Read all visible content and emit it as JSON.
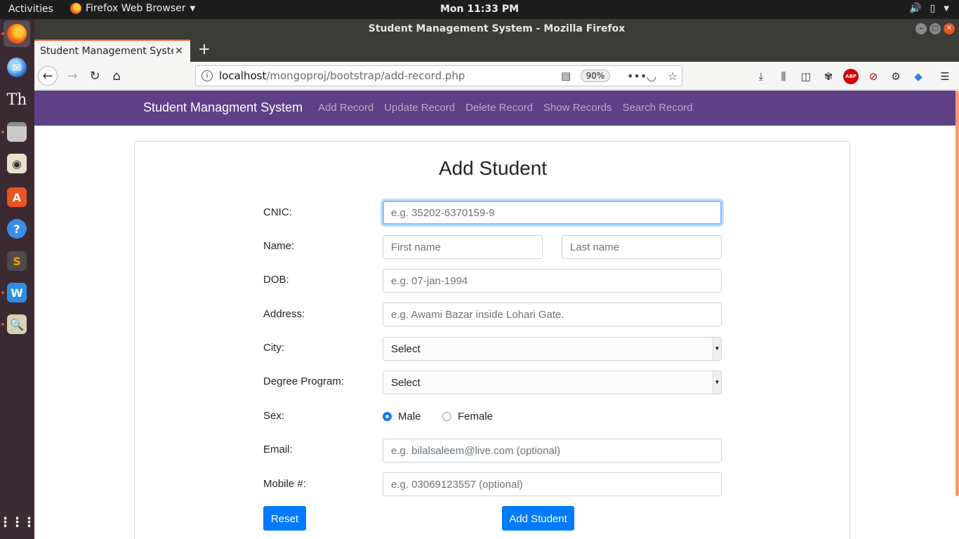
{
  "topbar": {
    "activities": "Activities",
    "app_name": "Firefox Web Browser",
    "clock": "Mon 11:33 PM"
  },
  "dock": {
    "items": [
      "firefox-icon",
      "thunderbird-icon",
      "font-viewer-icon",
      "files-icon",
      "rhythmbox-icon",
      "software-center-icon",
      "help-icon",
      "sublime-text-icon",
      "wps-writer-icon",
      "image-viewer-icon"
    ],
    "grid_label": "Show Applications"
  },
  "window": {
    "title": "Student Management System - Mozilla Firefox"
  },
  "tab": {
    "title": "Student Management System"
  },
  "urlbar": {
    "host": "localhost",
    "path": "/mongoproj/bootstrap/add-record.php",
    "zoom": "90%"
  },
  "site": {
    "brand": "Student Managment System",
    "links": [
      "Add Record",
      "Update Record",
      "Delete Record",
      "Show Records",
      "Search Record"
    ]
  },
  "form": {
    "title": "Add Student",
    "cnic_label": "CNIC:",
    "cnic_placeholder": "e.g. 35202-6370159-9",
    "name_label": "Name:",
    "first_name_placeholder": "First name",
    "last_name_placeholder": "Last name",
    "dob_label": "DOB:",
    "dob_placeholder": "e.g. 07-jan-1994",
    "address_label": "Address:",
    "address_placeholder": "e.g. Awami Bazar inside Lohari Gate.",
    "city_label": "City:",
    "city_value": "Select",
    "degree_label": "Degree Program:",
    "degree_value": "Select",
    "sex_label": "Sex:",
    "sex_male": "Male",
    "sex_female": "Female",
    "email_label": "Email:",
    "email_placeholder": "e.g. bilalsaleem@live.com (optional)",
    "mobile_label": "Mobile #:",
    "mobile_placeholder": "e.g. 03069123557 (optional)",
    "reset_label": "Reset",
    "submit_label": "Add Student"
  },
  "colors": {
    "navbar": "#5f3f86",
    "primary": "#007bff",
    "ubuntu_orange": "#e95420"
  }
}
